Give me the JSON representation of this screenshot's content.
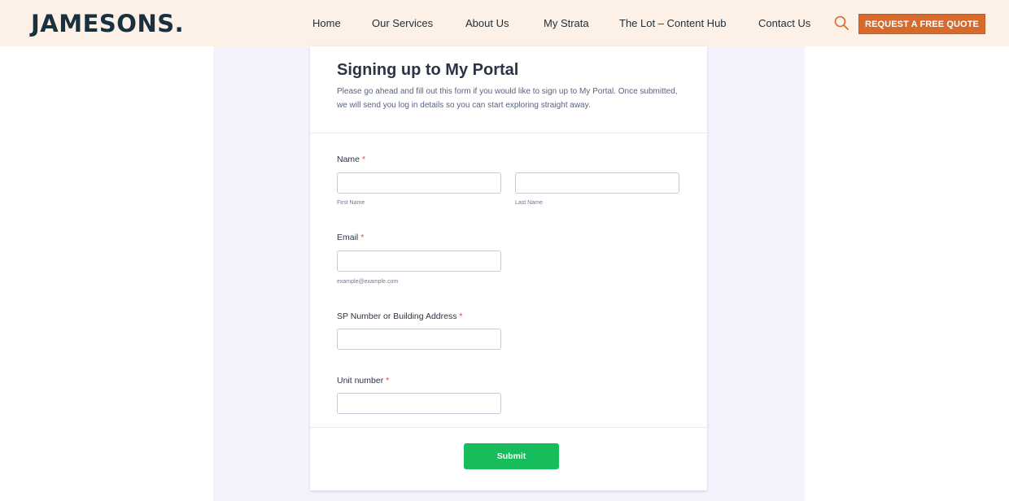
{
  "header": {
    "logo": "JAMESONS.",
    "nav": [
      "Home",
      "Our Services",
      "About Us",
      "My Strata",
      "The Lot – Content Hub",
      "Contact Us"
    ],
    "cta_label": "REQUEST A FREE QUOTE",
    "colors": {
      "background": "#fdf1e7",
      "logo": "#17313e",
      "accent": "#d56a2c"
    }
  },
  "form": {
    "title": "Signing up to My Portal",
    "description": "Please go ahead and fill out this form if you would like to sign up to My Portal. Once submitted, we will send you log in details so you can start exploring straight away.",
    "required_mark": "*",
    "fields": {
      "name": {
        "label": "Name",
        "first_sublabel": "First Name",
        "last_sublabel": "Last Name",
        "first_value": "",
        "last_value": ""
      },
      "email": {
        "label": "Email",
        "sublabel": "example@example.com",
        "value": ""
      },
      "address": {
        "label": "SP Number or Building Address",
        "value": ""
      },
      "unit": {
        "label": "Unit number",
        "value": ""
      }
    },
    "submit_label": "Submit",
    "colors": {
      "submit": "#18bd5b",
      "required": "#f23a3c",
      "backdrop": "#f2f3fd"
    }
  },
  "icons": {
    "search": "search-icon"
  }
}
